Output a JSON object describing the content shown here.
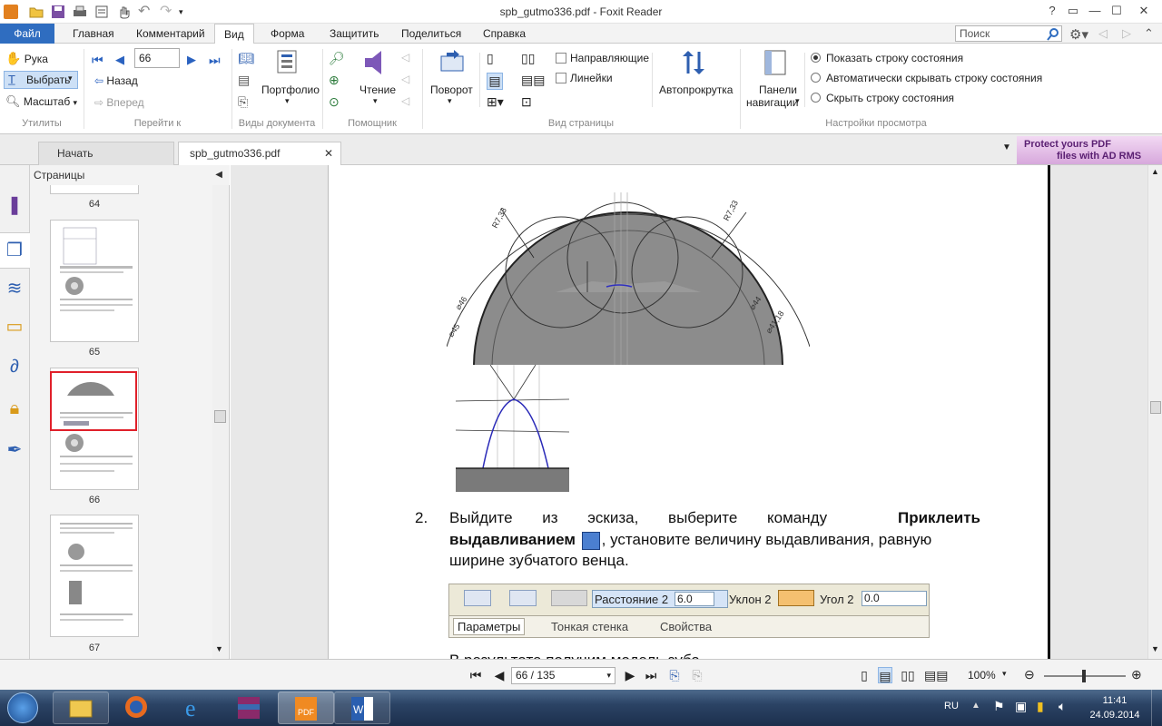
{
  "window": {
    "title": "spb_gutmo336.pdf - Foxit Reader",
    "controls": [
      "?",
      "▭",
      "—",
      "☐",
      "✕"
    ]
  },
  "menu": {
    "file": "Файл",
    "tabs": [
      "Главная",
      "Комментарий",
      "Вид",
      "Форма",
      "Защитить",
      "Поделиться",
      "Справка"
    ],
    "active_tab": "Вид",
    "search_placeholder": "Поиск"
  },
  "ribbon": {
    "utilities": {
      "label": "Утилиты",
      "hand": "Рука",
      "select": "Выбрать",
      "zoom": "Масштаб"
    },
    "goto": {
      "label": "Перейти к",
      "page_value": "66",
      "back": "Назад",
      "forward": "Вперед"
    },
    "doc_views": {
      "label": "Виды документа",
      "portfolio": "Портфолио"
    },
    "assistant": {
      "label": "Помощник",
      "reading": "Чтение"
    },
    "rotate": "Поворот",
    "page_view": {
      "label": "Вид страницы",
      "guides": "Направляющие",
      "rulers": "Линейки"
    },
    "autoscroll": "Автопрокрутка",
    "nav_panels_line1": "Панели",
    "nav_panels_line2": "навигации",
    "view_settings": {
      "label": "Настройки просмотра",
      "options": [
        "Показать строку состояния",
        "Автоматически скрывать строку состояния",
        "Скрыть строку состояния"
      ],
      "selected_index": 0
    }
  },
  "doc_tabs": {
    "start": "Начать",
    "file": "spb_gutmo336.pdf",
    "promo_line1": "Protect yours PDF",
    "promo_line2": "files with AD RMS"
  },
  "pages_panel": {
    "title": "Страницы",
    "thumbnails": [
      "64",
      "65",
      "66",
      "67"
    ],
    "selected": "66"
  },
  "document": {
    "dims": {
      "r_left": "R7,33",
      "r_right": "R7,33",
      "d46": "⌀46",
      "d45": "⌀45",
      "d44": "⌀44",
      "d41": "⌀41,18"
    },
    "step_number": "2.",
    "step_text_1": "Выйдите из эскиза, выберите команду",
    "step_bold_1": "Приклеить",
    "step_bold_2": "выдавливанием",
    "step_text_2": ", установите величину выдавливания, равную",
    "step_text_3": "ширине зубчатого венца.",
    "toolbar": {
      "distance_label": "Расстояние 2",
      "distance_value": "6.0",
      "slope_label": "Уклон 2",
      "angle_label": "Угол 2",
      "angle_value": "0.0",
      "tab_params": "Параметры",
      "tab_thin": "Тонкая стенка",
      "tab_props": "Свойства"
    },
    "bottom_text": "В результате получим модель зуба"
  },
  "status": {
    "page_display": "66 / 135",
    "zoom": "100%"
  },
  "taskbar": {
    "lang": "RU",
    "time": "11:41",
    "date": "24.09.2014"
  }
}
